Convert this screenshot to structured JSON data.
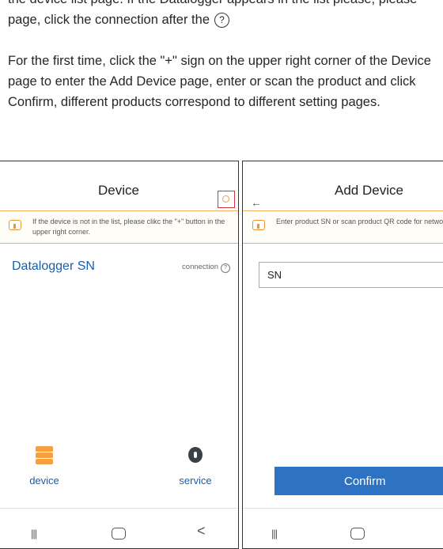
{
  "doc": {
    "line1": "the device list page. If the Datalogger appears in the list please, please refresh the",
    "line2": "page, click the connection after the",
    "para2": "For the first time, click the \"+\" sign on the upper right corner of the Device page to enter the Add Device page, enter or scan the product and click Confirm, different products correspond to different setting pages."
  },
  "left_phone": {
    "title": "Device",
    "tip": "If the device is not in the list, please clikc the \"+\" button in the upper right corner.",
    "datalogger_label": "Datalogger SN",
    "connection_label": "connection",
    "tabs": [
      {
        "label": "device",
        "icon": "device-icon"
      },
      {
        "label": "service",
        "icon": "service-icon"
      }
    ],
    "nav": {
      "recents": "|||",
      "back": "<"
    }
  },
  "right_phone": {
    "back": "←",
    "title": "Add Device",
    "tip": "Enter product SN or scan product QR code for network configuration",
    "sn_value": "SN",
    "confirm_label": "Confirm",
    "nav": {
      "recents": "|||"
    }
  },
  "colors": {
    "accent": "#2d73c2",
    "label_blue": "#1b5ea8",
    "tip_orange": "#e8953a",
    "highlight_red": "#d7333a"
  }
}
